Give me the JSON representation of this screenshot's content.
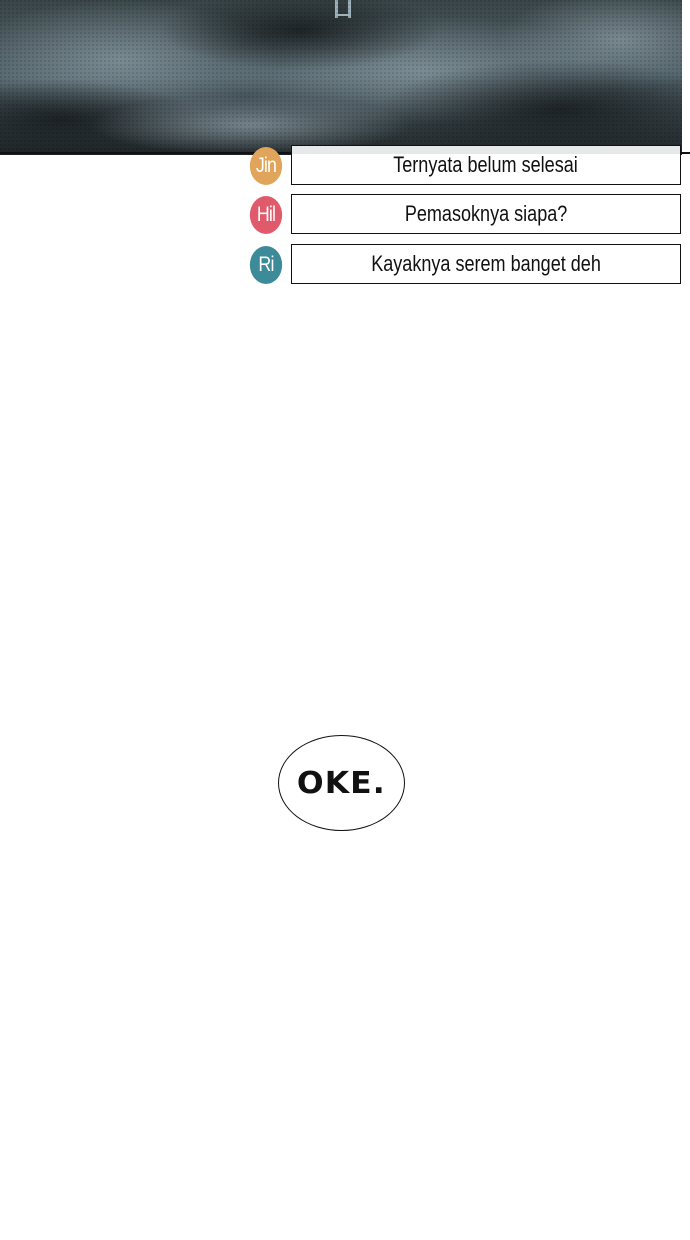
{
  "chat": [
    {
      "avatar": "Jin",
      "avatar_color": "#e0a55a",
      "text": "Ternyata belum selesai"
    },
    {
      "avatar": "Hil",
      "avatar_color": "#e05a6b",
      "text": "Pemasoknya siapa?"
    },
    {
      "avatar": "Ri",
      "avatar_color": "#3d8a98",
      "text": "Kayaknya serem banget deh"
    }
  ],
  "speech_bubble": {
    "text": "OKE."
  },
  "colors": {
    "panel_dark": "#2a3236",
    "panel_mid": "#4b5a60",
    "panel_light": "#7d8c90"
  }
}
